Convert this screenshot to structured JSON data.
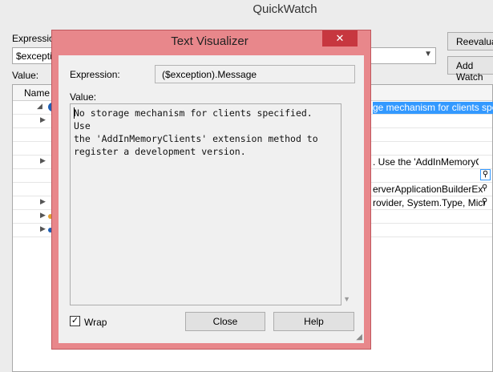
{
  "quickwatch": {
    "title": "QuickWatch",
    "expression_label": "Expression:",
    "expression_value": "$exception",
    "value_label": "Value:",
    "buttons": {
      "reevaluate": "Reevaluate",
      "add_watch": "Add Watch"
    },
    "grid": {
      "name_header": "Name",
      "rows": [
        {
          "value": "ge mechanism for clients speci",
          "selected": true,
          "magnifier": false
        },
        {
          "value": "",
          "selected": false,
          "magnifier": false
        },
        {
          "value": "",
          "selected": false,
          "magnifier": false
        },
        {
          "value": "",
          "selected": false,
          "magnifier": false
        },
        {
          "value": ". Use the 'AddInMemoryC",
          "selected": false,
          "magnifier": true
        },
        {
          "value": "",
          "selected": false,
          "magnifier": true
        },
        {
          "value": "erverApplicationBuilderEx",
          "selected": false,
          "magnifier": true
        },
        {
          "value": "rovider, System.Type, Micros",
          "selected": false,
          "magnifier": false
        },
        {
          "value": "",
          "selected": false,
          "magnifier": false
        },
        {
          "value": "",
          "selected": false,
          "magnifier": false
        }
      ]
    }
  },
  "visualizer": {
    "title": "Text Visualizer",
    "close_glyph": "✕",
    "expression_label": "Expression:",
    "expression_value": "($exception).Message",
    "value_label": "Value:",
    "value_text": "No storage mechanism for clients specified. Use\nthe 'AddInMemoryClients' extension method to\nregister a development version.",
    "wrap_label": "Wrap",
    "wrap_checked": true,
    "close_button": "Close",
    "help_button": "Help"
  },
  "colors": {
    "dialog_frame": "#e8878b",
    "close_button": "#c7373f",
    "selection": "#3399ff"
  }
}
